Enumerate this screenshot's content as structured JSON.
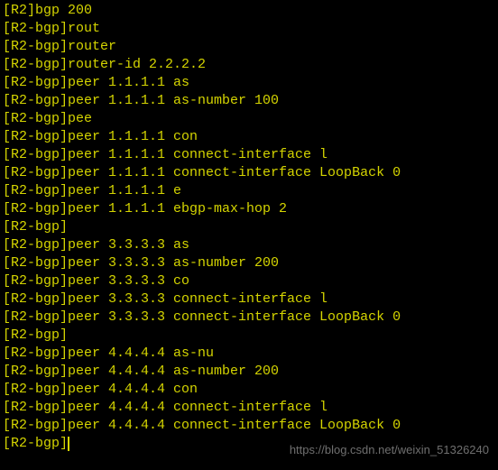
{
  "terminal": {
    "lines": [
      "[R2]bgp 200",
      "[R2-bgp]rout",
      "[R2-bgp]router",
      "[R2-bgp]router-id 2.2.2.2",
      "[R2-bgp]peer 1.1.1.1 as",
      "[R2-bgp]peer 1.1.1.1 as-number 100",
      "[R2-bgp]pee",
      "[R2-bgp]peer 1.1.1.1 con",
      "[R2-bgp]peer 1.1.1.1 connect-interface l",
      "[R2-bgp]peer 1.1.1.1 connect-interface LoopBack 0",
      "[R2-bgp]peer 1.1.1.1 e",
      "[R2-bgp]peer 1.1.1.1 ebgp-max-hop 2",
      "[R2-bgp]",
      "[R2-bgp]peer 3.3.3.3 as",
      "[R2-bgp]peer 3.3.3.3 as-number 200",
      "[R2-bgp]peer 3.3.3.3 co",
      "[R2-bgp]peer 3.3.3.3 connect-interface l",
      "[R2-bgp]peer 3.3.3.3 connect-interface LoopBack 0",
      "[R2-bgp]",
      "[R2-bgp]peer 4.4.4.4 as-nu",
      "[R2-bgp]peer 4.4.4.4 as-number 200",
      "[R2-bgp]peer 4.4.4.4 con",
      "[R2-bgp]peer 4.4.4.4 connect-interface l",
      "[R2-bgp]peer 4.4.4.4 connect-interface LoopBack 0",
      "[R2-bgp]"
    ]
  },
  "watermark": "https://blog.csdn.net/weixin_51326240"
}
